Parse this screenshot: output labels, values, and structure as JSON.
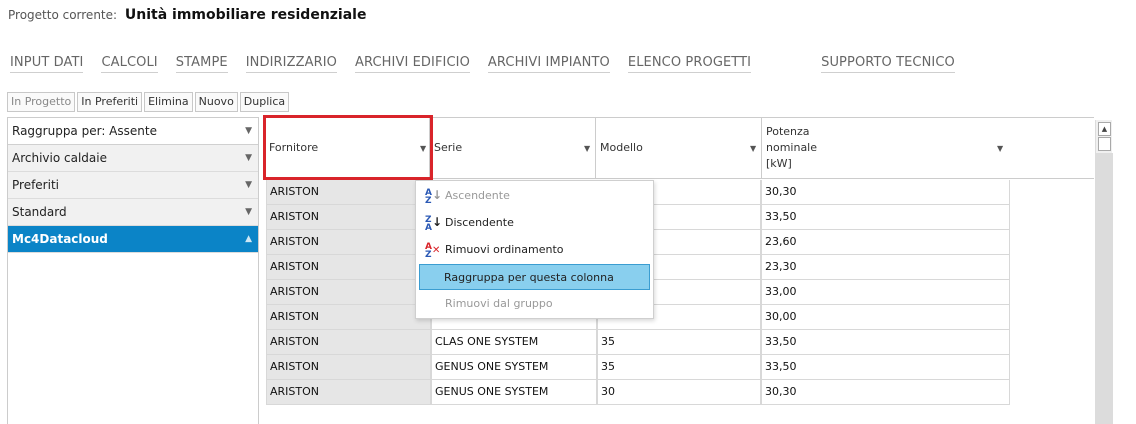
{
  "project": {
    "prefix": "Progetto corrente:",
    "name": "Unità immobiliare residenziale"
  },
  "nav": {
    "input_dati": "INPUT DATI",
    "calcoli": "CALCOLI",
    "stampe": "STAMPE",
    "indirizzario": "INDIRIZZARIO",
    "archivi_edificio": "ARCHIVI EDIFICIO",
    "archivi_impianto": "ARCHIVI IMPIANTO",
    "elenco_progetti": "ELENCO PROGETTI",
    "supporto_tecnico": "SUPPORTO TECNICO"
  },
  "toolbar": {
    "in_progetto": "In Progetto",
    "in_preferiti": "In Preferiti",
    "elimina": "Elimina",
    "nuovo": "Nuovo",
    "duplica": "Duplica"
  },
  "left_panel": {
    "group_by": "Raggruppa per:  Assente",
    "groups": [
      "Archivio caldaie",
      "Preferiti",
      "Standard",
      "Mc4Datacloud"
    ],
    "selected": "Mc4Datacloud"
  },
  "grid": {
    "columns": {
      "fornitore": "Fornitore",
      "serie": "Serie",
      "modello": "Modello",
      "potenza": [
        "Potenza",
        "nominale",
        "[kW]"
      ]
    },
    "rows": [
      {
        "fornitore": "ARISTON",
        "serie": "",
        "modello": "",
        "potenza": "30,30"
      },
      {
        "fornitore": "ARISTON",
        "serie": "",
        "modello": "",
        "potenza": "33,50"
      },
      {
        "fornitore": "ARISTON",
        "serie": "",
        "modello": "",
        "potenza": "23,60"
      },
      {
        "fornitore": "ARISTON",
        "serie": "",
        "modello": "",
        "potenza": "23,30"
      },
      {
        "fornitore": "ARISTON",
        "serie": "",
        "modello": "",
        "potenza": "33,00"
      },
      {
        "fornitore": "ARISTON",
        "serie": "",
        "modello": "",
        "potenza": "30,00"
      },
      {
        "fornitore": "ARISTON",
        "serie": "CLAS ONE SYSTEM",
        "modello": "35",
        "potenza": "33,50"
      },
      {
        "fornitore": "ARISTON",
        "serie": "GENUS ONE SYSTEM",
        "modello": "35",
        "potenza": "33,50"
      },
      {
        "fornitore": "ARISTON",
        "serie": "GENUS ONE SYSTEM",
        "modello": "30",
        "potenza": "30,30"
      }
    ]
  },
  "context_menu": {
    "ascendente": "Ascendente",
    "discendente": "Discendente",
    "rimuovi_ordinamento": "Rimuovi ordinamento",
    "raggruppa": "Raggruppa per questa colonna",
    "rimuovi_gruppo": "Rimuovi dal gruppo"
  },
  "colors": {
    "accent": "#0b84c7",
    "highlight_border": "#d9242a",
    "menu_highlight": "#89cfee"
  }
}
